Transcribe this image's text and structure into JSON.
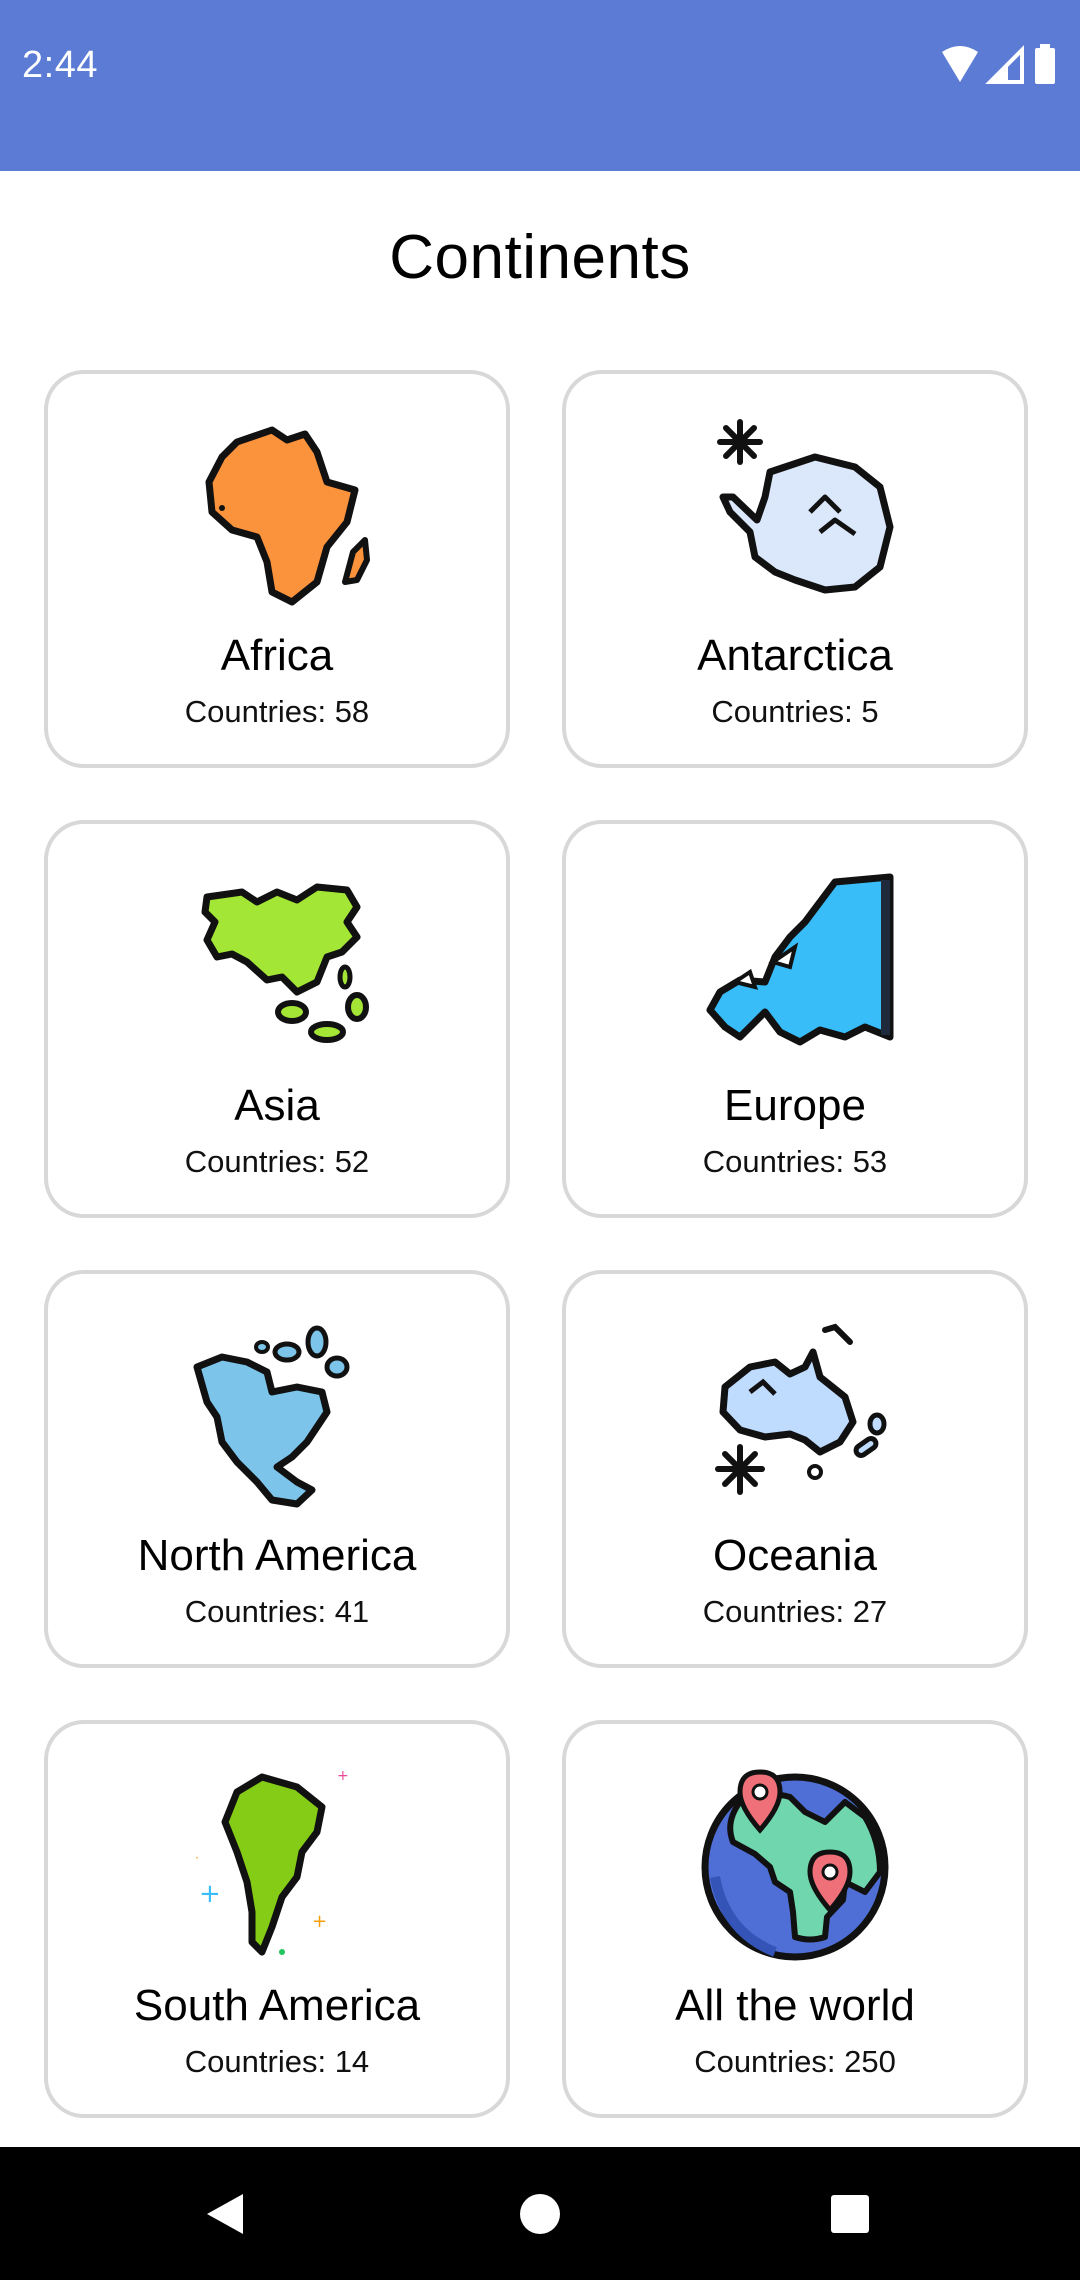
{
  "status_bar": {
    "time": "2:44",
    "background": "#5b7bd5",
    "icons": [
      "wifi-icon",
      "signal-icon",
      "battery-icon"
    ]
  },
  "page": {
    "title": "Continents"
  },
  "continents": [
    {
      "name": "Africa",
      "count_label": "Countries: 58",
      "icon": "africa-map-icon"
    },
    {
      "name": "Antarctica",
      "count_label": "Countries: 5",
      "icon": "antarctica-map-icon"
    },
    {
      "name": "Asia",
      "count_label": "Countries: 52",
      "icon": "asia-map-icon"
    },
    {
      "name": "Europe",
      "count_label": "Countries: 53",
      "icon": "europe-map-icon"
    },
    {
      "name": "North America",
      "count_label": "Countries: 41",
      "icon": "north-america-map-icon"
    },
    {
      "name": "Oceania",
      "count_label": "Countries: 27",
      "icon": "oceania-map-icon"
    },
    {
      "name": "South America",
      "count_label": "Countries: 14",
      "icon": "south-america-map-icon"
    },
    {
      "name": "All the world",
      "count_label": "Countries: 250",
      "icon": "globe-icon"
    }
  ],
  "nav_bar": {
    "buttons": [
      "back-icon",
      "home-icon",
      "recents-icon"
    ]
  }
}
